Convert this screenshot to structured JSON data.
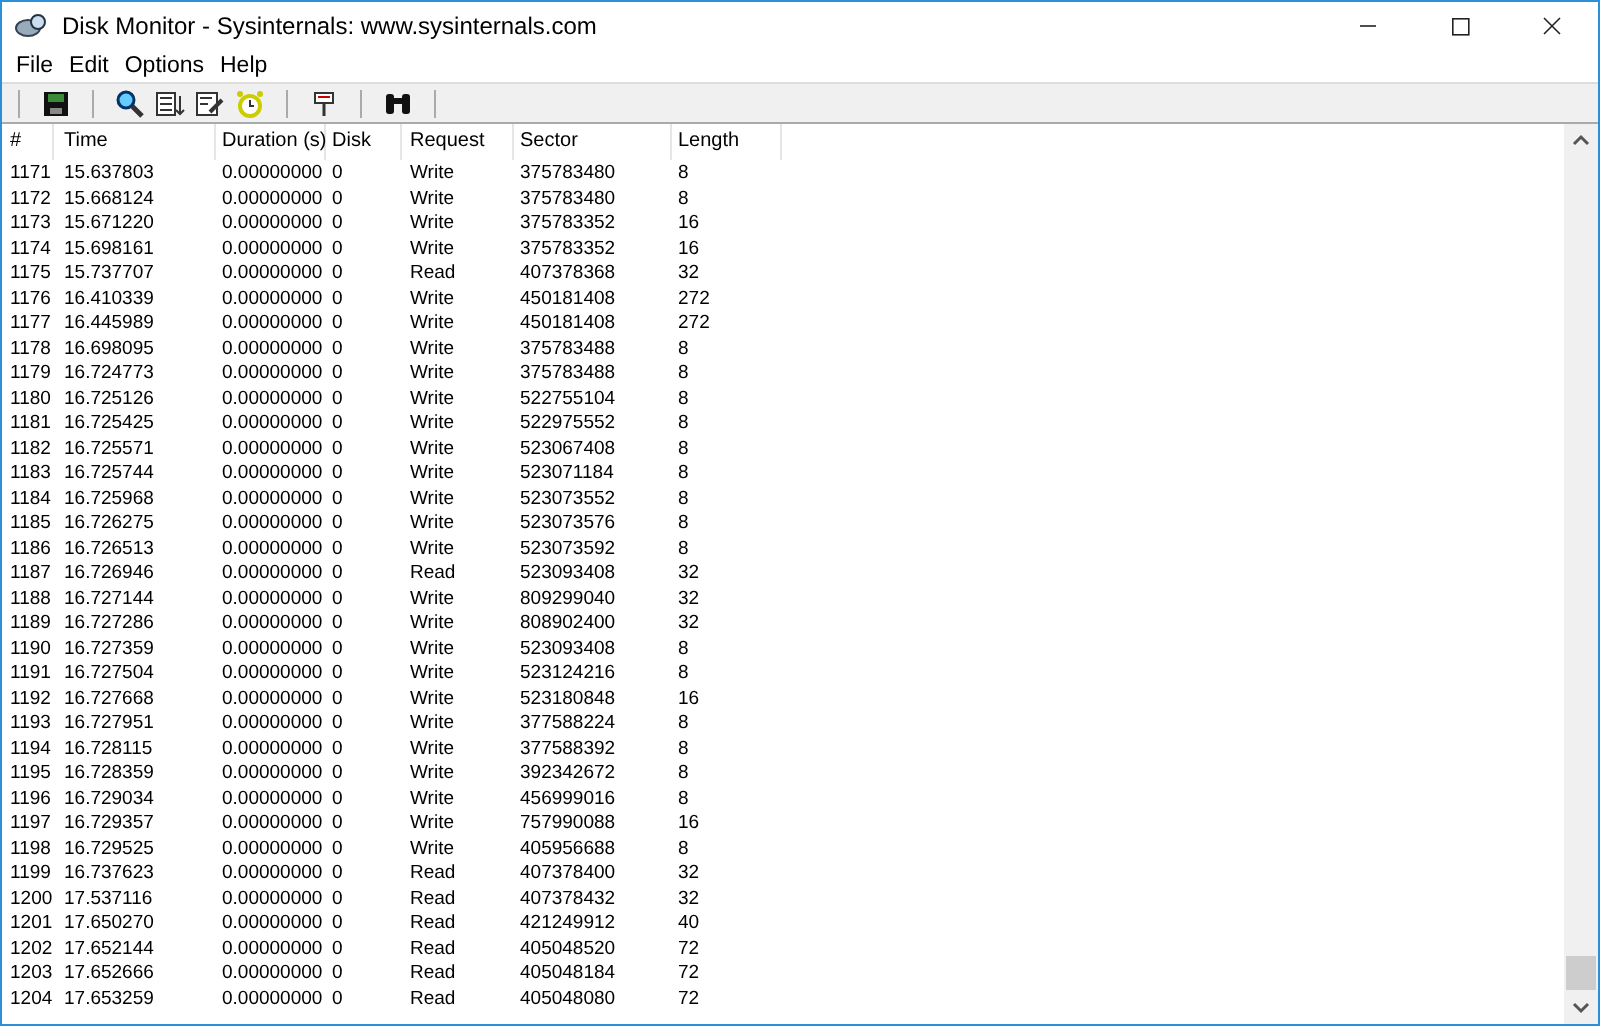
{
  "window": {
    "title": "Disk Monitor - Sysinternals: www.sysinternals.com"
  },
  "menu": [
    "File",
    "Edit",
    "Options",
    "Help"
  ],
  "table": {
    "columns": [
      "#",
      "Time",
      "Duration (s)",
      "Disk",
      "Request",
      "Sector",
      "Length"
    ],
    "rows": [
      [
        "1171",
        "15.637803",
        "0.00000000",
        "0",
        "Write",
        "375783480",
        "8"
      ],
      [
        "1172",
        "15.668124",
        "0.00000000",
        "0",
        "Write",
        "375783480",
        "8"
      ],
      [
        "1173",
        "15.671220",
        "0.00000000",
        "0",
        "Write",
        "375783352",
        "16"
      ],
      [
        "1174",
        "15.698161",
        "0.00000000",
        "0",
        "Write",
        "375783352",
        "16"
      ],
      [
        "1175",
        "15.737707",
        "0.00000000",
        "0",
        "Read",
        "407378368",
        "32"
      ],
      [
        "1176",
        "16.410339",
        "0.00000000",
        "0",
        "Write",
        "450181408",
        "272"
      ],
      [
        "1177",
        "16.445989",
        "0.00000000",
        "0",
        "Write",
        "450181408",
        "272"
      ],
      [
        "1178",
        "16.698095",
        "0.00000000",
        "0",
        "Write",
        "375783488",
        "8"
      ],
      [
        "1179",
        "16.724773",
        "0.00000000",
        "0",
        "Write",
        "375783488",
        "8"
      ],
      [
        "1180",
        "16.725126",
        "0.00000000",
        "0",
        "Write",
        "522755104",
        "8"
      ],
      [
        "1181",
        "16.725425",
        "0.00000000",
        "0",
        "Write",
        "522975552",
        "8"
      ],
      [
        "1182",
        "16.725571",
        "0.00000000",
        "0",
        "Write",
        "523067408",
        "8"
      ],
      [
        "1183",
        "16.725744",
        "0.00000000",
        "0",
        "Write",
        "523071184",
        "8"
      ],
      [
        "1184",
        "16.725968",
        "0.00000000",
        "0",
        "Write",
        "523073552",
        "8"
      ],
      [
        "1185",
        "16.726275",
        "0.00000000",
        "0",
        "Write",
        "523073576",
        "8"
      ],
      [
        "1186",
        "16.726513",
        "0.00000000",
        "0",
        "Write",
        "523073592",
        "8"
      ],
      [
        "1187",
        "16.726946",
        "0.00000000",
        "0",
        "Read",
        "523093408",
        "32"
      ],
      [
        "1188",
        "16.727144",
        "0.00000000",
        "0",
        "Write",
        "809299040",
        "32"
      ],
      [
        "1189",
        "16.727286",
        "0.00000000",
        "0",
        "Write",
        "808902400",
        "32"
      ],
      [
        "1190",
        "16.727359",
        "0.00000000",
        "0",
        "Write",
        "523093408",
        "8"
      ],
      [
        "1191",
        "16.727504",
        "0.00000000",
        "0",
        "Write",
        "523124216",
        "8"
      ],
      [
        "1192",
        "16.727668",
        "0.00000000",
        "0",
        "Write",
        "523180848",
        "16"
      ],
      [
        "1193",
        "16.727951",
        "0.00000000",
        "0",
        "Write",
        "377588224",
        "8"
      ],
      [
        "1194",
        "16.728115",
        "0.00000000",
        "0",
        "Write",
        "377588392",
        "8"
      ],
      [
        "1195",
        "16.728359",
        "0.00000000",
        "0",
        "Write",
        "392342672",
        "8"
      ],
      [
        "1196",
        "16.729034",
        "0.00000000",
        "0",
        "Write",
        "456999016",
        "8"
      ],
      [
        "1197",
        "16.729357",
        "0.00000000",
        "0",
        "Write",
        "757990088",
        "16"
      ],
      [
        "1198",
        "16.729525",
        "0.00000000",
        "0",
        "Write",
        "405956688",
        "8"
      ],
      [
        "1199",
        "16.737623",
        "0.00000000",
        "0",
        "Read",
        "407378400",
        "32"
      ],
      [
        "1200",
        "17.537116",
        "0.00000000",
        "0",
        "Read",
        "407378432",
        "32"
      ],
      [
        "1201",
        "17.650270",
        "0.00000000",
        "0",
        "Read",
        "421249912",
        "40"
      ],
      [
        "1202",
        "17.652144",
        "0.00000000",
        "0",
        "Read",
        "405048520",
        "72"
      ],
      [
        "1203",
        "17.652666",
        "0.00000000",
        "0",
        "Read",
        "405048184",
        "72"
      ],
      [
        "1204",
        "17.653259",
        "0.00000000",
        "0",
        "Read",
        "405048080",
        "72"
      ]
    ]
  }
}
